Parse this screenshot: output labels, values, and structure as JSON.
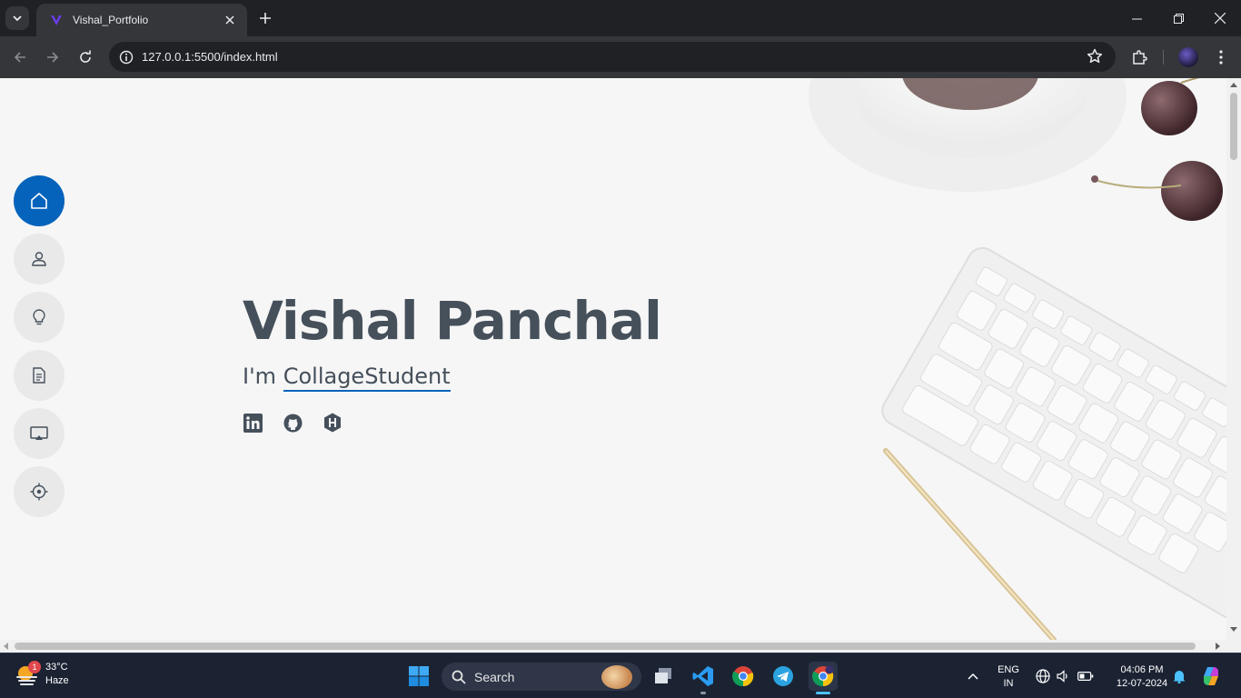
{
  "browser": {
    "tab_title": "Vishal_Portfolio",
    "url": "127.0.0.1:5500/index.html"
  },
  "page": {
    "name": "Vishal Panchal",
    "subtitle_prefix": "I'm",
    "typed_text": "CollageStudent",
    "accent_color": "#0563bb",
    "text_color": "#45505b",
    "nav_items": [
      {
        "label": "Home",
        "icon": "home-icon",
        "active": true
      },
      {
        "label": "About",
        "icon": "person-icon",
        "active": false
      },
      {
        "label": "Skills",
        "icon": "bulb-icon",
        "active": false
      },
      {
        "label": "Resume",
        "icon": "document-icon",
        "active": false
      },
      {
        "label": "Portfolio",
        "icon": "display-icon",
        "active": false
      },
      {
        "label": "Contact",
        "icon": "target-icon",
        "active": false
      }
    ],
    "social_links": [
      "linkedin-icon",
      "github-icon",
      "hackerrank-icon"
    ]
  },
  "taskbar": {
    "weather_temp": "33°C",
    "weather_desc": "Haze",
    "weather_badge": "1",
    "search_label": "Search",
    "lang_line1": "ENG",
    "lang_line2": "IN",
    "time": "04:06 PM",
    "date": "12-07-2024"
  }
}
